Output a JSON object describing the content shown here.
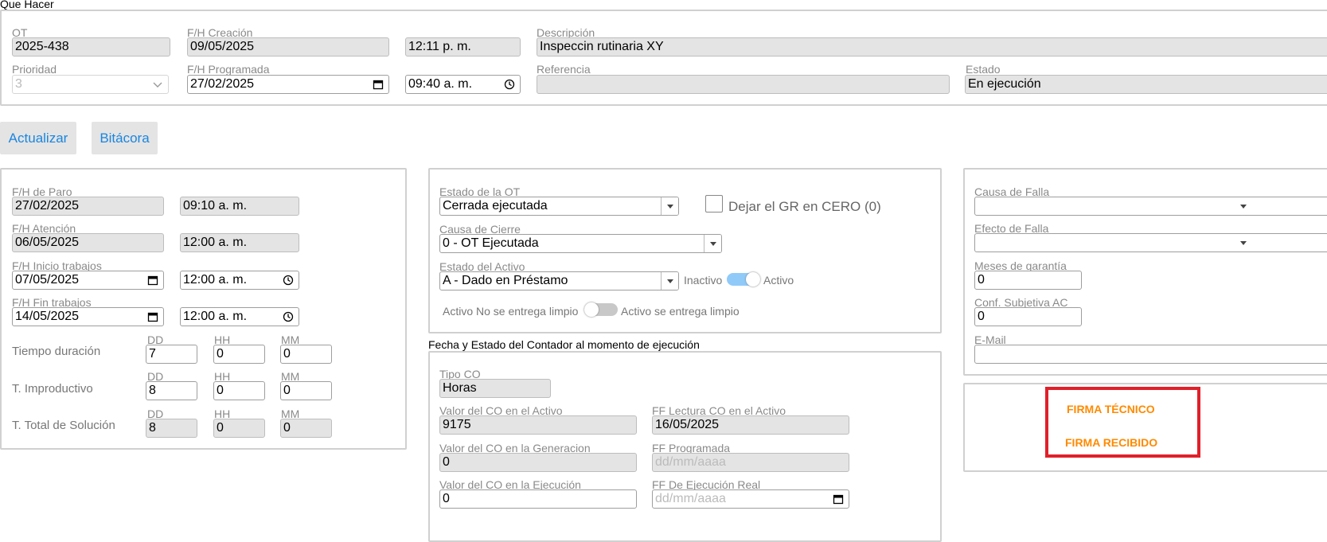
{
  "header": {
    "section_title": "Que Hacer"
  },
  "top": {
    "ot": {
      "label": "OT",
      "value": "2025-438"
    },
    "fh_creacion": {
      "label": "F/H Creación",
      "date": "09/05/2025",
      "time": "12:11 p. m."
    },
    "descripcion": {
      "label": "Descripción",
      "value": "Inspeccin rutinaria XY"
    },
    "prioridad": {
      "label": "Prioridad",
      "value": "3"
    },
    "fh_programada": {
      "label": "F/H Programada",
      "date": "27/02/2025",
      "time": "09:40 a. m."
    },
    "referencia": {
      "label": "Referencia",
      "value": ""
    },
    "estado": {
      "label": "Estado",
      "value": "En ejecución"
    }
  },
  "buttons": {
    "actualizar": "Actualizar",
    "bitacora": "Bitácora"
  },
  "left": {
    "fh_paro": {
      "label": "F/H de Paro",
      "date": "27/02/2025",
      "time": "09:10 a. m."
    },
    "fh_atencion": {
      "label": "F/H Atención",
      "date": "06/05/2025",
      "time": "12:00 a. m."
    },
    "fh_inicio": {
      "label": "F/H Inicio trabajos",
      "date": "07/05/2025",
      "time": "12:00 a. m."
    },
    "fh_fin": {
      "label": "F/H Fin trabajos",
      "date": "14/05/2025",
      "time": "12:00 a. m."
    },
    "units": {
      "dd": "DD",
      "hh": "HH",
      "mm": "MM"
    },
    "tiempo_duracion": {
      "label": "Tiempo duración",
      "dd": "7",
      "hh": "0",
      "mm": "0"
    },
    "t_improductivo": {
      "label": "T. Improductivo",
      "dd": "8",
      "hh": "0",
      "mm": "0"
    },
    "t_total": {
      "label": "T. Total de Solución",
      "dd": "8",
      "hh": "0",
      "mm": "0"
    }
  },
  "middle": {
    "estado_ot": {
      "label": "Estado de la OT",
      "value": "Cerrada ejecutada"
    },
    "dejar_gr": {
      "label": "Dejar el GR en CERO (0)",
      "checked": false
    },
    "causa_cierre": {
      "label": "Causa de Cierre",
      "value": "0 - OT Ejecutada"
    },
    "estado_activo": {
      "label": "Estado del Activo",
      "value": "A - Dado en Préstamo"
    },
    "toggle_activo": {
      "off_label": "Inactivo",
      "on_label": "Activo",
      "on": true
    },
    "toggle_limpio": {
      "off_label": "Activo No se entrega limpio",
      "on_label": "Activo se entrega limpio",
      "on": false
    }
  },
  "contador": {
    "section_title": "Fecha y Estado del Contador al momento de ejecución",
    "tipo_co": {
      "label": "Tipo CO",
      "value": "Horas"
    },
    "valor_activo": {
      "label": "Valor del CO en el Activo",
      "value": "9175"
    },
    "ff_lectura": {
      "label": "FF Lectura CO en el Activo",
      "value": "16/05/2025"
    },
    "valor_generacion": {
      "label": "Valor del CO en la Generacion",
      "value": "0"
    },
    "ff_programada": {
      "label": "FF Programada",
      "placeholder": "dd/mm/aaaa"
    },
    "valor_ejecucion": {
      "label": "Valor del CO en la Ejecución",
      "value": "0"
    },
    "ff_ejecucion_real": {
      "label": "FF De Ejecución Real",
      "placeholder": "dd/mm/aaaa"
    }
  },
  "right": {
    "causa_falla": {
      "label": "Causa de Falla",
      "value": ""
    },
    "efecto_falla": {
      "label": "Efecto de Falla",
      "value": ""
    },
    "meses_garantia": {
      "label": "Meses de garantía",
      "value": "0"
    },
    "conf_subjetiva": {
      "label": "Conf. Subjetiva AC",
      "value": "0"
    },
    "email": {
      "label": "E-Mail",
      "value": ""
    }
  },
  "firmas": {
    "tecnico": "FIRMA TÉCNICO",
    "recibido": "FIRMA RECIBIDO",
    "highlight_color": "#e0202a",
    "text_color": "#ff8a00"
  },
  "colors": {
    "link_blue": "#1a86e0",
    "toggle_on": "#90caf9",
    "toggle_off": "#bdbdbd"
  }
}
